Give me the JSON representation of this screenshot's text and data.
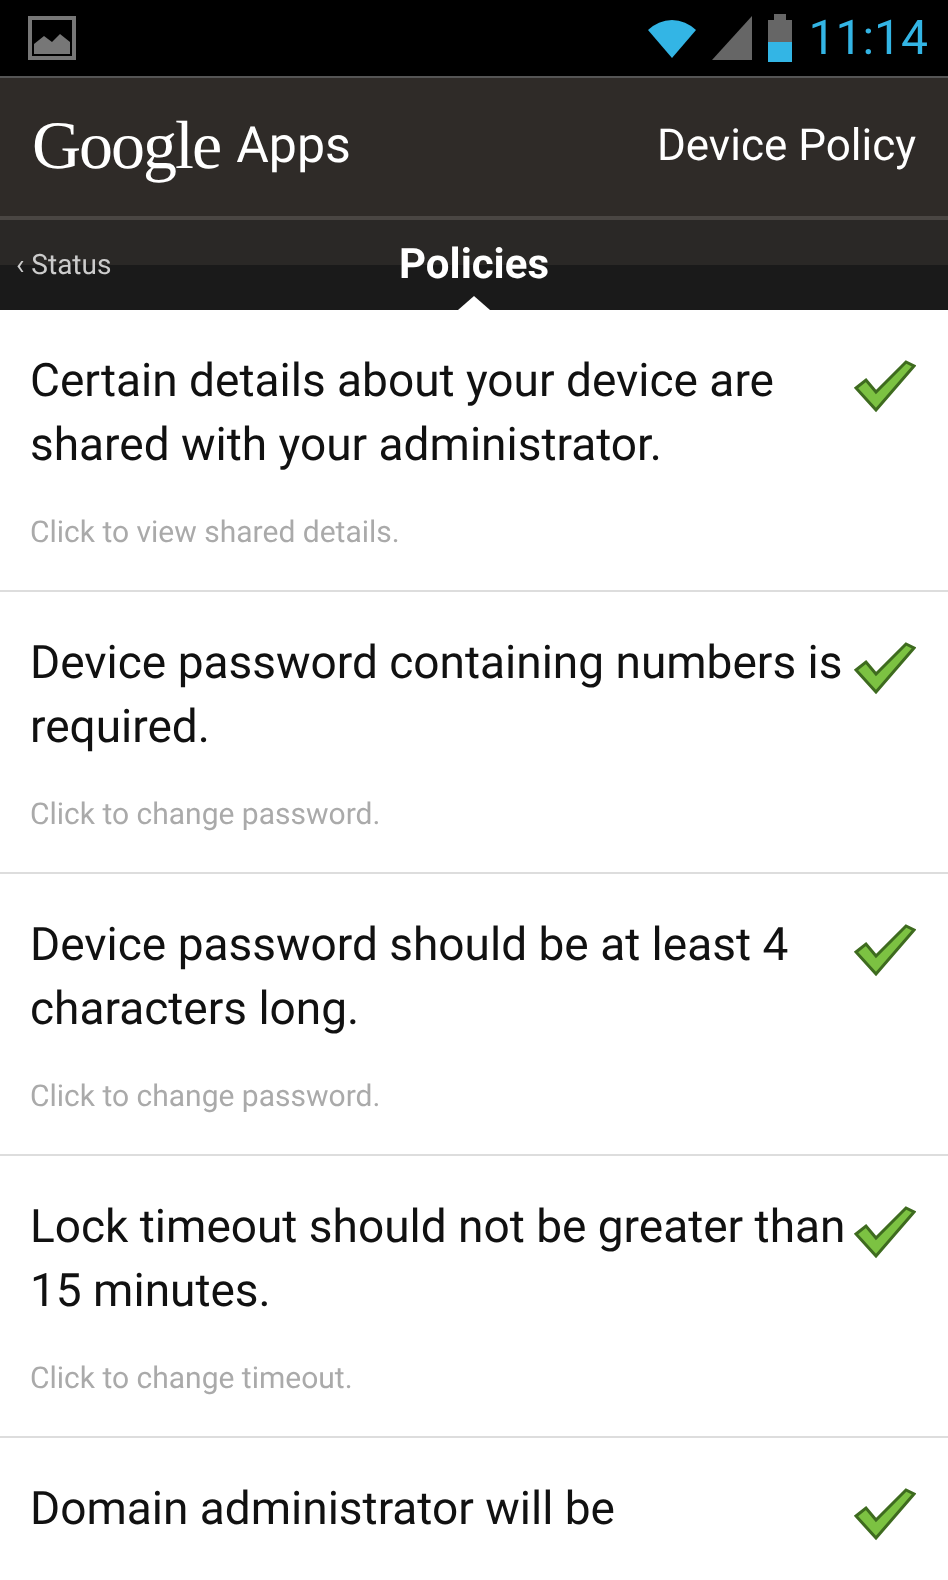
{
  "status_bar": {
    "time": "11:14"
  },
  "header": {
    "logo": "Google",
    "app": "Apps",
    "title": "Device Policy"
  },
  "tabs": [
    {
      "label": "‹ Status",
      "selected": false
    },
    {
      "label": "Policies",
      "selected": true
    }
  ],
  "policies": [
    {
      "title": "Certain details about your device are shared with your administrator.",
      "hint": "Click to view shared details.",
      "checked": true
    },
    {
      "title": "Device password containing numbers is required.",
      "hint": "Click to change password.",
      "checked": true
    },
    {
      "title": "Device password should be at least 4 characters long.",
      "hint": "Click to change password.",
      "checked": true
    },
    {
      "title": "Lock timeout should not be greater than 15 minutes.",
      "hint": "Click to change timeout.",
      "checked": true
    },
    {
      "title": "Domain administrator will be",
      "checked": true
    }
  ]
}
